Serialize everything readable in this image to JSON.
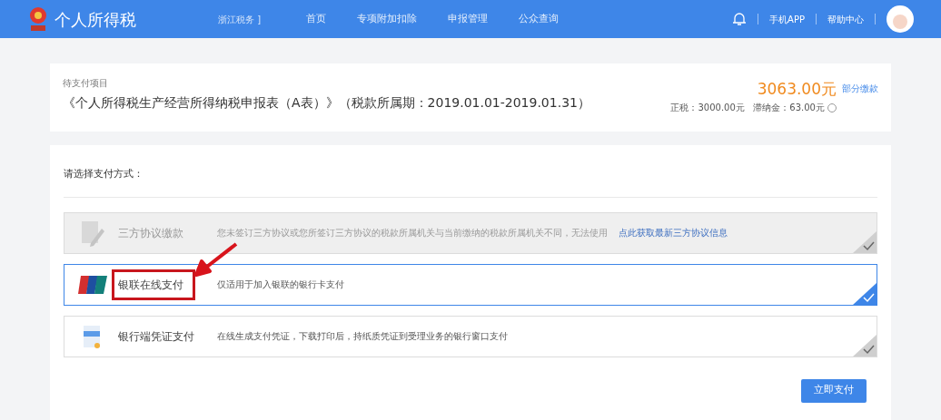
{
  "header": {
    "title": "个人所得税",
    "region": "浙江税务 ]",
    "nav": [
      {
        "label": "首页",
        "selected": false
      },
      {
        "label": "专项附加扣除",
        "selected": false
      },
      {
        "label": "申报管理",
        "selected": false
      },
      {
        "label": "公众查询",
        "selected": false
      }
    ],
    "links": [
      "手机APP",
      "帮助中心"
    ]
  },
  "summary": {
    "caption": "待支付项目",
    "title": "《个人所得税生产经营所得纳税申报表（A表）》（税款所属期：2019.01.01-2019.01.31）",
    "amount": "3063.00元",
    "partial_link": "部分缴款",
    "detail": "正税：3000.00元   滞纳金：63.00元"
  },
  "payment": {
    "heading": "请选择支付方式：",
    "options": [
      {
        "kind": "agreement",
        "name": "三方协议缴款",
        "description": "您未签订三方协议或您所签订三方协议的税款所属机关与当前缴纳的税款所属机关不同，无法使用",
        "link": "点此获取最新三方协议信息",
        "disabled": true,
        "selected": false,
        "highlighted": false
      },
      {
        "kind": "unionpay",
        "name": "银联在线支付",
        "description": "仅适用于加入银联的银行卡支付",
        "disabled": false,
        "selected": true,
        "highlighted": true
      },
      {
        "kind": "voucher",
        "name": "银行端凭证支付",
        "description": "在线生成支付凭证，下载打印后，持纸质凭证到受理业务的银行窗口支付",
        "disabled": false,
        "selected": false,
        "highlighted": false
      }
    ],
    "button": "立即支付"
  }
}
